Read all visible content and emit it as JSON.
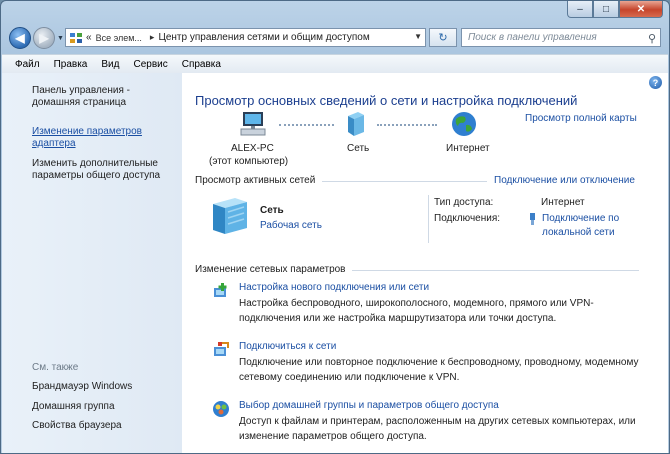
{
  "window": {
    "caption_buttons": {
      "minimize": "–",
      "maximize": "□",
      "close": "✕"
    }
  },
  "nav": {
    "breadcrumb_prefix": "«",
    "crumb1": "Все элем...",
    "arrow": "▸",
    "crumb2": "Центр управления сетями и общим доступом",
    "search_placeholder": "Поиск в панели управления"
  },
  "menu": [
    "Файл",
    "Правка",
    "Вид",
    "Сервис",
    "Справка"
  ],
  "sidebar": {
    "home": "Панель управления -\nдомашняя страница",
    "link1": "Изменение параметров\nадаптера",
    "link2": "Изменить дополнительные\nпараметры общего доступа",
    "see_also": "См. также",
    "also1": "Брандмауэр Windows",
    "also2": "Домашняя группа",
    "also3": "Свойства браузера"
  },
  "main": {
    "help": "?",
    "title": "Просмотр основных сведений о сети и настройка подключений",
    "full_map": "Просмотр полной карты",
    "map": {
      "pc_name": "ALEX-PC",
      "pc_sub": "(этот компьютер)",
      "network": "Сеть",
      "internet": "Интернет"
    },
    "active_header": "Просмотр активных сетей",
    "connect_disconnect": "Подключение или отключение",
    "active": {
      "name": "Сеть",
      "type": "Рабочая сеть",
      "access_label": "Тип доступа:",
      "access_value": "Интернет",
      "conn_label": "Подключения:",
      "conn_value_1": "Подключение по",
      "conn_value_2": "локальной сети"
    },
    "change_header": "Изменение сетевых параметров",
    "tasks": [
      {
        "title": "Настройка нового подключения или сети",
        "desc": "Настройка беспроводного, широкополосного, модемного, прямого или VPN-подключения или же настройка маршрутизатора или точки доступа.",
        "icon": "new-connection-icon"
      },
      {
        "title": "Подключиться к сети",
        "desc": "Подключение или повторное подключение к беспроводному, проводному, модемному сетевому соединению или подключение к VPN.",
        "icon": "connect-network-icon"
      },
      {
        "title": "Выбор домашней группы и параметров общего доступа",
        "desc": "Доступ к файлам и принтерам, расположенным на других сетевых компьютерах, или изменение параметров общего доступа.",
        "icon": "homegroup-icon"
      }
    ]
  },
  "colors": {
    "link": "#1b4fa3",
    "title": "#1c3f8f",
    "sidebar_bg": "#e3ecf6"
  }
}
